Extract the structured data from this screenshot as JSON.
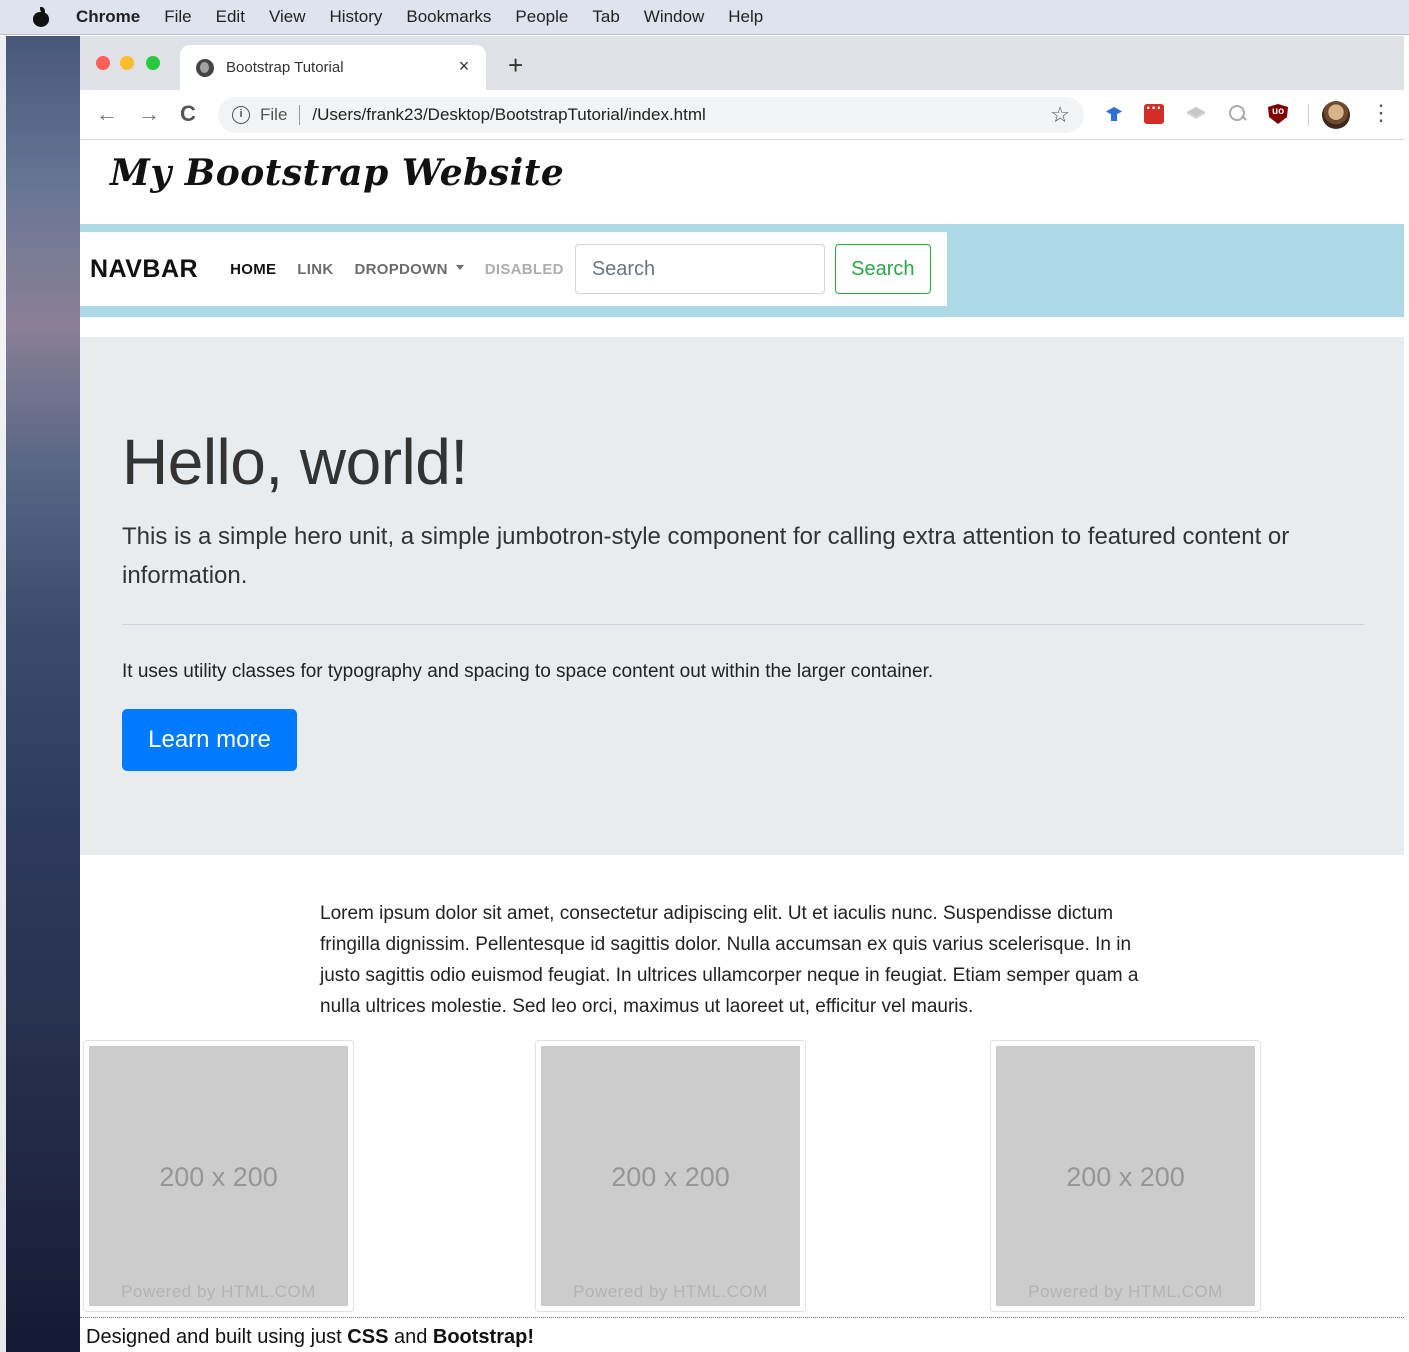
{
  "menubar": {
    "items": [
      "Chrome",
      "File",
      "Edit",
      "View",
      "History",
      "Bookmarks",
      "People",
      "Tab",
      "Window",
      "Help"
    ]
  },
  "browser": {
    "tab_title": "Bootstrap Tutorial",
    "tab_close": "×",
    "new_tab": "+",
    "nav_back": "←",
    "nav_forward": "→",
    "nav_reload": "C",
    "info_glyph": "i",
    "scheme": "File",
    "url": "/Users/frank23/Desktop/BootstrapTutorial/index.html",
    "star": "☆",
    "menu": "⋮",
    "icons": [
      "globe-icon",
      "graduation-cap-icon",
      "lastpass-icon",
      "layers-icon",
      "zoom-icon",
      "ublock-icon",
      "profile-avatar",
      "kebab-menu-icon"
    ]
  },
  "site": {
    "logo": "My Bootstrap Website"
  },
  "navbar": {
    "brand": "NAVBAR",
    "links": [
      {
        "label": "HOME",
        "state": "active"
      },
      {
        "label": "LINK",
        "state": "normal"
      },
      {
        "label": "DROPDOWN",
        "state": "dropdown"
      },
      {
        "label": "DISABLED",
        "state": "disabled"
      }
    ],
    "search_placeholder": "Search",
    "search_button": "Search"
  },
  "jumbotron": {
    "title": "Hello, world!",
    "lead": "This is a simple hero unit, a simple jumbotron-style component for calling extra attention to featured content or information.",
    "text": "It uses utility classes for typography and spacing to space content out within the larger container.",
    "button": "Learn more"
  },
  "content": {
    "lorem": "Lorem ipsum dolor sit amet, consectetur adipiscing elit. Ut et iaculis nunc. Suspendisse dictum fringilla dignissim. Pellentesque id sagittis dolor. Nulla accumsan ex quis varius scelerisque. In in justo sagittis odio euismod feugiat. In ultrices ullamcorper neque in feugiat. Etiam semper quam a nulla ultrices molestie. Sed leo orci, maximus ut laoreet ut, efficitur vel mauris."
  },
  "thumbnails": [
    {
      "size": "200 x 200",
      "powered": "Powered by HTML.COM"
    },
    {
      "size": "200 x 200",
      "powered": "Powered by HTML.COM"
    },
    {
      "size": "200 x 200",
      "powered": "Powered by HTML.COM"
    }
  ],
  "footer": {
    "prefix": "Designed and built using just ",
    "css": "CSS",
    "and": " and ",
    "bootstrap": "Bootstrap!"
  },
  "colors": {
    "nav_band": "#add8e6",
    "jumbotron_bg": "#e9ecef",
    "primary": "#007bff",
    "success": "#28a745",
    "placeholder_gray": "#cccccc"
  }
}
